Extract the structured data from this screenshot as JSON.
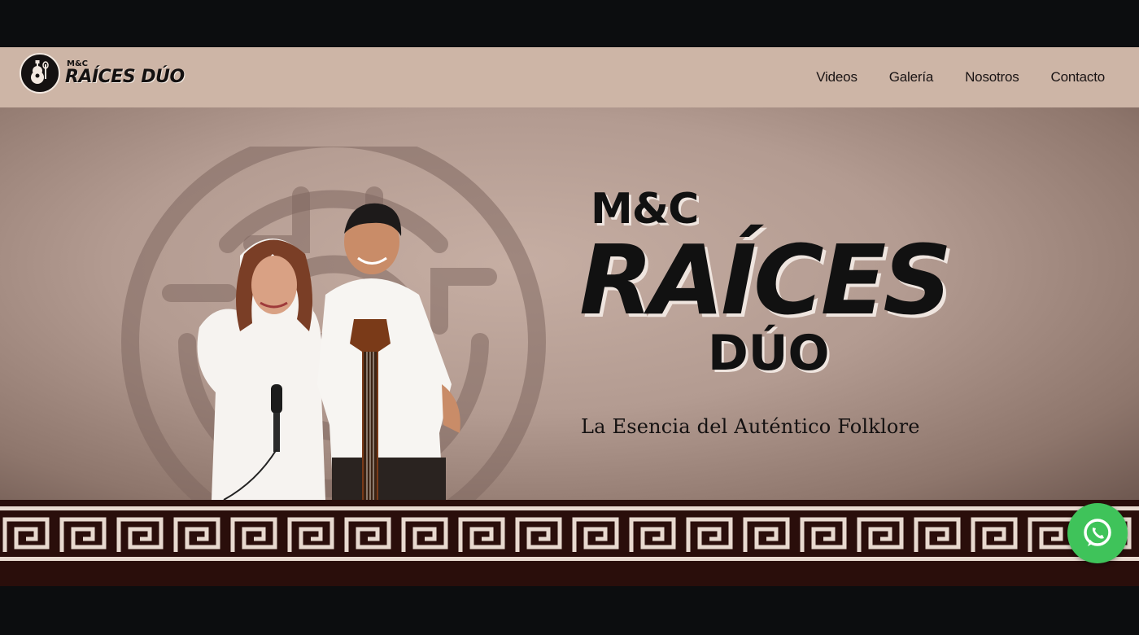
{
  "brand": {
    "logo_small": "M&C",
    "logo_big": "RAÍCES DÚO"
  },
  "nav": {
    "items": [
      {
        "label": "Videos"
      },
      {
        "label": "Galería"
      },
      {
        "label": "Nosotros"
      },
      {
        "label": "Contacto"
      }
    ]
  },
  "hero": {
    "title_small": "M&C",
    "title_big": "RAÍCES",
    "title_duo": "DÚO",
    "tagline": "La Esencia del Auténtico Folklore"
  },
  "colors": {
    "nav_bg": "#cdb5a6",
    "hero_bg": "#b39b91",
    "band_bg": "#2a0e0b",
    "whatsapp": "#3fc35a"
  },
  "icons": {
    "logo": "guitar-logo-icon",
    "whatsapp": "whatsapp-icon"
  }
}
